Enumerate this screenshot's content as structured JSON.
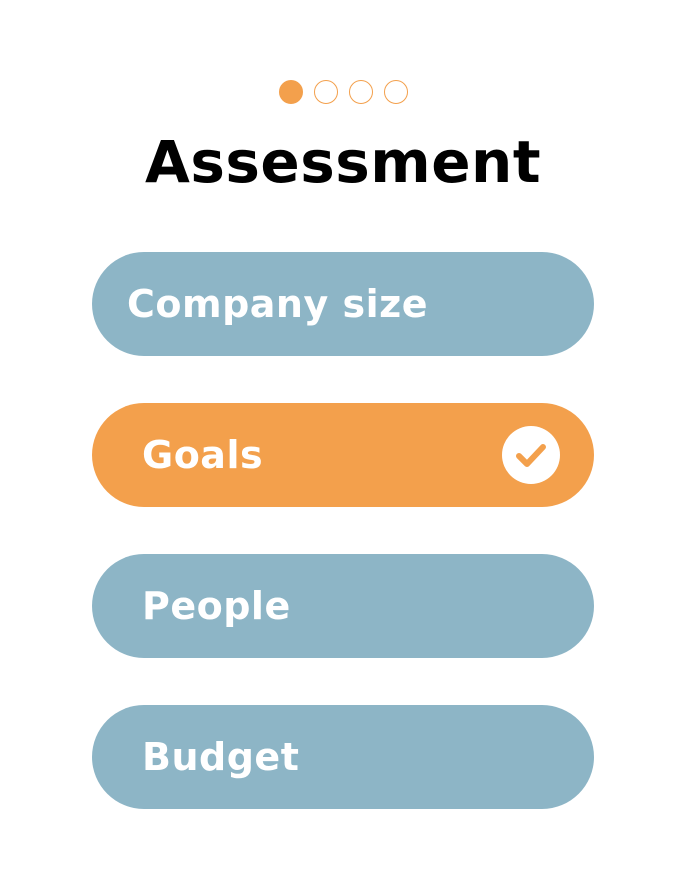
{
  "pager": {
    "total": 4,
    "current": 1,
    "active_color": "#f3a04c"
  },
  "title": "Assessment",
  "options": [
    {
      "label": "Company size",
      "selected": false
    },
    {
      "label": "Goals",
      "selected": true,
      "icon": "checkmark-circle-icon"
    },
    {
      "label": "People",
      "selected": false
    },
    {
      "label": "Budget",
      "selected": false
    }
  ],
  "colors": {
    "option_default": "#8db5c6",
    "option_selected": "#f3a04c",
    "text": "#ffffff"
  }
}
